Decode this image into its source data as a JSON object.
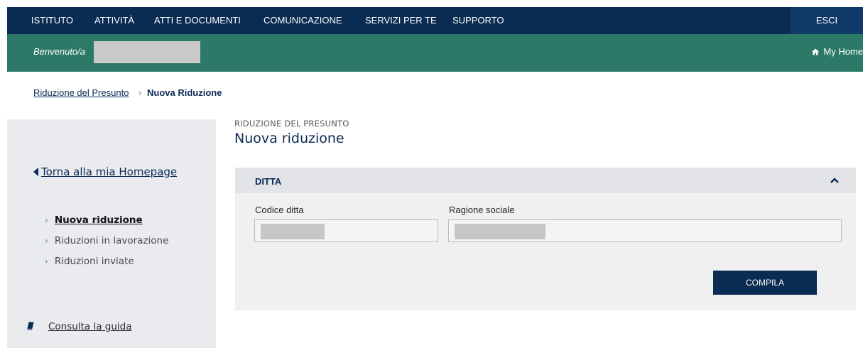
{
  "nav": {
    "items": [
      "ISTITUTO",
      "ATTIVITÀ",
      "ATTI E DOCUMENTI",
      "COMUNICAZIONE",
      "SERVIZI PER TE",
      "SUPPORTO"
    ],
    "logout": "ESCI"
  },
  "welcome": {
    "text": "Benvenuto/a",
    "my_home": "My Home"
  },
  "breadcrumb": {
    "parent": "Riduzione del Presunto",
    "separator": "›",
    "current": "Nuova Riduzione"
  },
  "sidebar": {
    "back": "Torna alla mia Homepage",
    "items": [
      {
        "label": "Nuova riduzione",
        "active": true
      },
      {
        "label": "Riduzioni in lavorazione",
        "active": false
      },
      {
        "label": "Riduzioni inviate",
        "active": false
      }
    ],
    "guide": "Consulta la guida"
  },
  "main": {
    "kicker": "RIDUZIONE DEL PRESUNTO",
    "title": "Nuova riduzione",
    "panel": {
      "title": "DITTA",
      "fields": {
        "codice": {
          "label": "Codice ditta"
        },
        "ragione": {
          "label": "Ragione sociale"
        }
      },
      "submit": "COMPILA"
    }
  },
  "colors": {
    "nav": "#0a2b52",
    "welcome_bar": "#2d7968",
    "sidebar": "#e9ebef",
    "panel": "#f0f0f0",
    "panel_header": "#e2e4e8"
  },
  "icons": {
    "home": "home-icon",
    "back": "caret-left-icon",
    "chevron": "chevron-right-icon",
    "guide": "book-icon",
    "collapse": "caret-up-icon"
  }
}
